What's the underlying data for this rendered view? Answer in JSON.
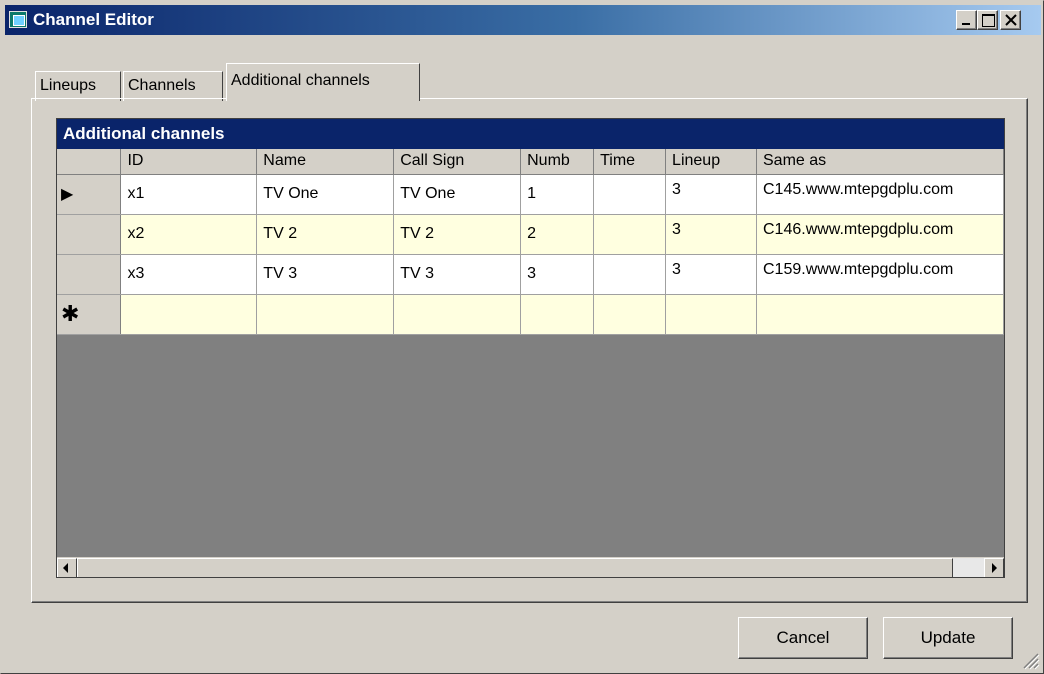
{
  "window": {
    "title": "Channel Editor"
  },
  "tabs": [
    {
      "label": "Lineups"
    },
    {
      "label": "Channels"
    },
    {
      "label": "Additional channels"
    }
  ],
  "grid": {
    "caption": "Additional channels",
    "columns": [
      "ID",
      "Name",
      "Call Sign",
      "Numb",
      "Time",
      "Lineup",
      "Same as"
    ],
    "rows": [
      {
        "indicator": "▶",
        "id": "x1",
        "name": "TV One",
        "call_sign": "TV One",
        "numb": "1",
        "time": "",
        "lineup": "3",
        "same_as": "C145.www.mtepgdplu.com"
      },
      {
        "indicator": "",
        "id": "x2",
        "name": "TV 2",
        "call_sign": "TV 2",
        "numb": "2",
        "time": "",
        "lineup": "3",
        "same_as": "C146.www.mtepgdplu.com"
      },
      {
        "indicator": "",
        "id": "x3",
        "name": "TV 3",
        "call_sign": "TV 3",
        "numb": "3",
        "time": "",
        "lineup": "3",
        "same_as": "C159.www.mtepgdplu.com"
      }
    ],
    "new_row_indicator": "✱"
  },
  "buttons": {
    "cancel": "Cancel",
    "update": "Update"
  },
  "colors": {
    "title_bar": "#0a246a",
    "grid_caption": "#0a246a",
    "alt_row": "#ffffe0",
    "grid_background": "#808080"
  }
}
